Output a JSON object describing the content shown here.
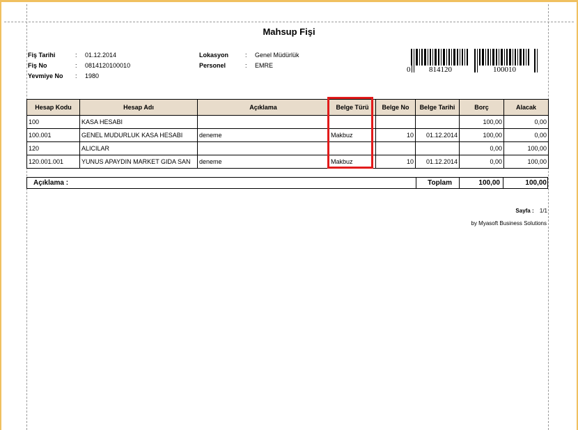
{
  "document": {
    "title": "Mahsup Fişi",
    "meta_left": [
      {
        "label": "Fiş Tarihi",
        "value": "01.12.2014"
      },
      {
        "label": "Fiş No",
        "value": "0814120100010"
      },
      {
        "label": "Yevmiye No",
        "value": "1980"
      }
    ],
    "meta_right": [
      {
        "label": "Lokasyon",
        "value": "Genel Müdürlük"
      },
      {
        "label": "Personel",
        "value": "EMRE"
      }
    ],
    "barcode_text": [
      "0",
      "814120",
      "100010"
    ]
  },
  "table": {
    "headers": [
      "Hesap Kodu",
      "Hesap Adı",
      "Açıklama",
      "Belge Türü",
      "Belge No",
      "Belge Tarihi",
      "Borç",
      "Alacak"
    ],
    "rows": [
      [
        "100",
        "KASA HESABI",
        "",
        "",
        "",
        "",
        "100,00",
        "0,00"
      ],
      [
        "100.001",
        "GENEL MUDURLUK KASA HESABI",
        "deneme",
        "Makbuz",
        "10",
        "01.12.2014",
        "100,00",
        "0,00"
      ],
      [
        "120",
        "ALICILAR",
        "",
        "",
        "",
        "",
        "0,00",
        "100,00"
      ],
      [
        "120.001.001",
        "YUNUS APAYDIN MARKET GIDA SAN",
        "deneme",
        "Makbuz",
        "10",
        "01.12.2014",
        "0,00",
        "100,00"
      ]
    ]
  },
  "summary": {
    "aciklama_label": "Açıklama :",
    "toplam_label": "Toplam",
    "borc_total": "100,00",
    "alacak_total": "100,00"
  },
  "footer": {
    "page_label": "Sayfa :",
    "page_value": "1/1",
    "credit": "by Myasoft Business Solutions"
  },
  "colors": {
    "header_bg": "#e8dccb",
    "highlight": "#e21b1b",
    "window_frame": "#f0c060"
  }
}
